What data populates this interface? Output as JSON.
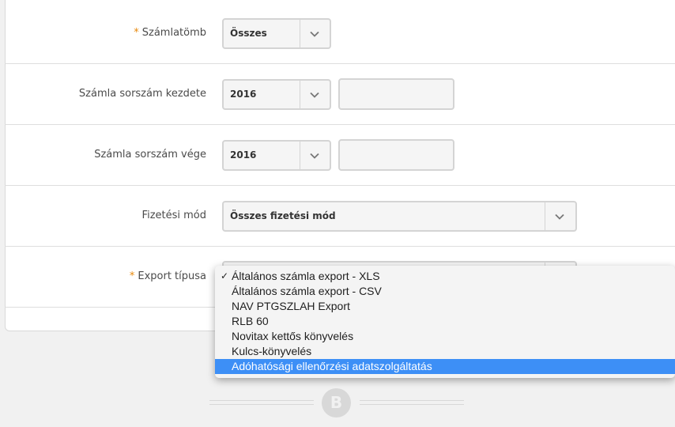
{
  "fields": {
    "szamlatomb": {
      "label": "Számlatömb",
      "value": "Összes"
    },
    "kezdete": {
      "label": "Számla sorszám kezdete",
      "year": "2016",
      "number": ""
    },
    "vege": {
      "label": "Számla sorszám vége",
      "year": "2016",
      "number": ""
    },
    "fizetesi_mod": {
      "label": "Fizetési mód",
      "value": "Összes fizetési mód"
    },
    "export_tipusa": {
      "label": "Export típusa"
    }
  },
  "required_marker": "*",
  "dropdown": {
    "check_mark": "✓",
    "options": [
      "Általános számla export - XLS",
      "Általános számla export - CSV",
      "NAV PTGSZLAH Export",
      "RLB 60",
      "Novitax kettős könyvelés",
      "Kulcs-könyvelés",
      "Adóhatósági ellenőrzési adatszolgáltatás"
    ],
    "selected_index": 0,
    "highlighted_index": 6
  },
  "footer": {
    "logo_glyph": "B"
  },
  "colors": {
    "highlight": "#3d8ff6",
    "required": "#e8890c"
  }
}
